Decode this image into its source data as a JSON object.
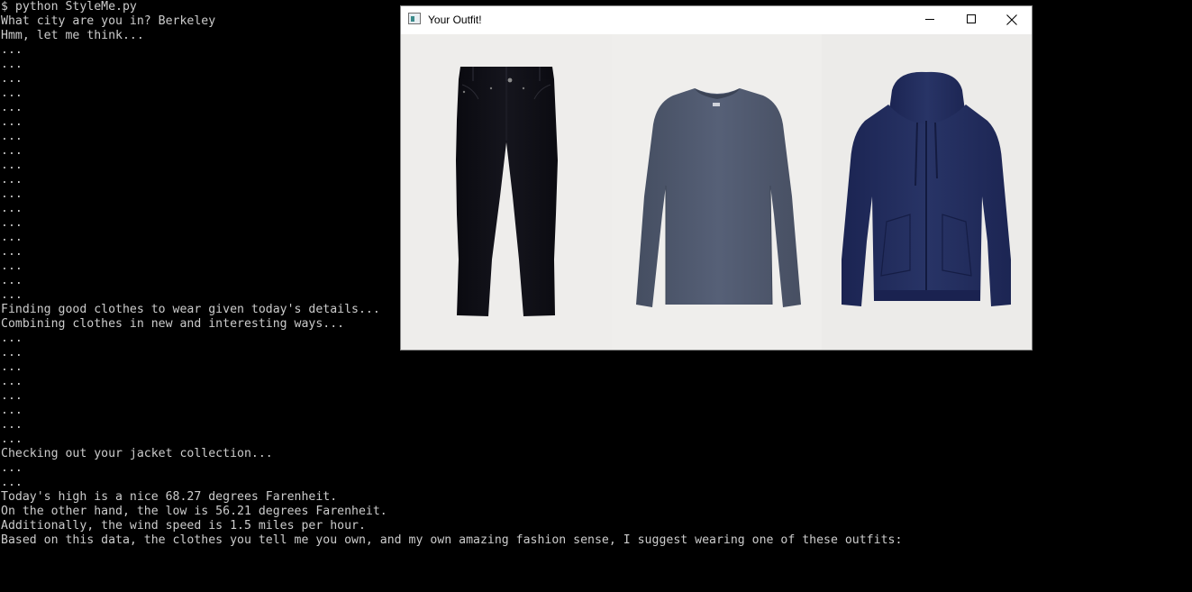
{
  "terminal": {
    "lines": [
      "$ python StyleMe.py",
      "What city are you in? Berkeley",
      "Hmm, let me think...",
      "...",
      "...",
      "...",
      "...",
      "...",
      "...",
      "...",
      "...",
      "...",
      "...",
      "...",
      "...",
      "...",
      "...",
      "...",
      "...",
      "...",
      "...",
      "Finding good clothes to wear given today's details...",
      "Combining clothes in new and interesting ways...",
      "...",
      "...",
      "...",
      "...",
      "...",
      "...",
      "...",
      "...",
      "Checking out your jacket collection...",
      "...",
      "...",
      "Today's high is a nice 68.27 degrees Farenheit.",
      "On the other hand, the low is 56.21 degrees Farenheit.",
      "Additionally, the wind speed is 1.5 miles per hour.",
      "Based on this data, the clothes you tell me you own, and my own amazing fashion sense, I suggest wearing one of these outfits:"
    ]
  },
  "window": {
    "title": "Your Outfit!",
    "app_icon": "window-app-icon",
    "controls": {
      "minimize": "minimize-icon",
      "maximize": "maximize-icon",
      "close": "close-icon"
    }
  },
  "outfit": {
    "items": [
      {
        "name": "pants",
        "icon": "jeans-image",
        "color": "#111118"
      },
      {
        "name": "shirt",
        "icon": "long-sleeve-shirt-image",
        "color": "#4d566a"
      },
      {
        "name": "jacket",
        "icon": "zip-hoodie-image",
        "color": "#1f2a5c"
      }
    ]
  },
  "colors": {
    "terminal_bg": "#000000",
    "terminal_fg": "#cccccc",
    "window_bg": "#ffffff"
  }
}
